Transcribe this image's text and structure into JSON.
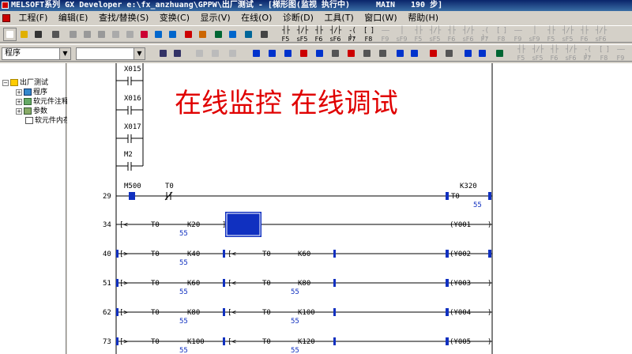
{
  "window": {
    "title_main": "MELSOFT系列 GX Developer e:\\fx_anzhuang\\GPPW\\出厂测试 - [梯形图(监视 执行中)",
    "program_name": "MAIN",
    "steps": "190 步]"
  },
  "menu": [
    "工程(F)",
    "编辑(E)",
    "查找/替换(S)",
    "变换(C)",
    "显示(V)",
    "在线(O)",
    "诊断(D)",
    "工具(T)",
    "窗口(W)",
    "帮助(H)"
  ],
  "toolbar2": {
    "program_combo": "程序",
    "empty_combo": ""
  },
  "fkeys": [
    {
      "sym": "┤├",
      "key": "F5"
    },
    {
      "sym": "┤/├",
      "key": "sF5"
    },
    {
      "sym": "┤├",
      "key": "F6"
    },
    {
      "sym": "┤/├",
      "key": "sF6"
    },
    {
      "sym": "-( )-",
      "key": "F7"
    },
    {
      "sym": "[ ]",
      "key": "F8"
    },
    {
      "sym": "——",
      "key": "F9"
    },
    {
      "sym": "│",
      "key": "sF9"
    }
  ],
  "tree": [
    {
      "label": "出厂测试",
      "level": 0
    },
    {
      "label": "程序",
      "level": 1
    },
    {
      "label": "软元件注释",
      "level": 1
    },
    {
      "label": "参数",
      "level": 1
    },
    {
      "label": "软元件内存",
      "level": 1
    }
  ],
  "overlay_text": "在线监控    在线调试",
  "ladder": {
    "top_contacts": [
      "X015",
      "X016",
      "X017",
      "M2"
    ],
    "rungs": [
      {
        "step": "29",
        "c1": "M500",
        "c2": "T0",
        "coil": "T0",
        "coil_k": "K320",
        "coil_val": "55"
      },
      {
        "step": "34",
        "cmp": "<",
        "a": "T0",
        "b": "K20",
        "bval": "55",
        "coil": "Y001"
      },
      {
        "step": "40",
        "cmp": ">",
        "a": "T0",
        "b": "K40",
        "bval": "55",
        "cmp2": "<",
        "a2": "T0",
        "b2": "K60",
        "coil": "Y002"
      },
      {
        "step": "51",
        "cmp": ">",
        "a": "T0",
        "b": "K60",
        "bval": "55",
        "cmp2": "<",
        "a2": "T0",
        "b2": "K80",
        "b2val": "55",
        "coil": "Y003"
      },
      {
        "step": "62",
        "cmp": ">",
        "a": "T0",
        "b": "K80",
        "bval": "55",
        "cmp2": "<",
        "a2": "T0",
        "b2": "K100",
        "b2val": "55",
        "coil": "Y004"
      },
      {
        "step": "73",
        "cmp": ">",
        "a": "T0",
        "b": "K100",
        "bval": "55",
        "cmp2": "<",
        "a2": "T0",
        "b2": "K120",
        "b2val": "55",
        "coil": "Y005"
      }
    ]
  }
}
